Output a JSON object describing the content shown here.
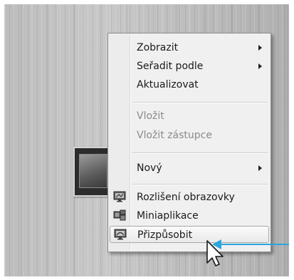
{
  "menu": {
    "items": [
      {
        "label": "Zobrazit",
        "submenu": true,
        "enabled": true
      },
      {
        "label": "Seřadit podle",
        "submenu": true,
        "enabled": true
      },
      {
        "label": "Aktualizovat",
        "submenu": false,
        "enabled": true
      },
      {
        "label": "Vložit",
        "submenu": false,
        "enabled": false
      },
      {
        "label": "Vložit zástupce",
        "submenu": false,
        "enabled": false
      },
      {
        "label": "Nový",
        "submenu": true,
        "enabled": true
      },
      {
        "label": "Rozlišení obrazovky",
        "submenu": false,
        "enabled": true,
        "icon": "screen-resolution-icon"
      },
      {
        "label": "Miniaplikace",
        "submenu": false,
        "enabled": true,
        "icon": "gadgets-icon"
      },
      {
        "label": "Přizpůsobit",
        "submenu": false,
        "enabled": true,
        "icon": "personalize-icon",
        "highlighted": true
      }
    ]
  },
  "colors": {
    "callout_arrow": "#2aa7dd"
  }
}
